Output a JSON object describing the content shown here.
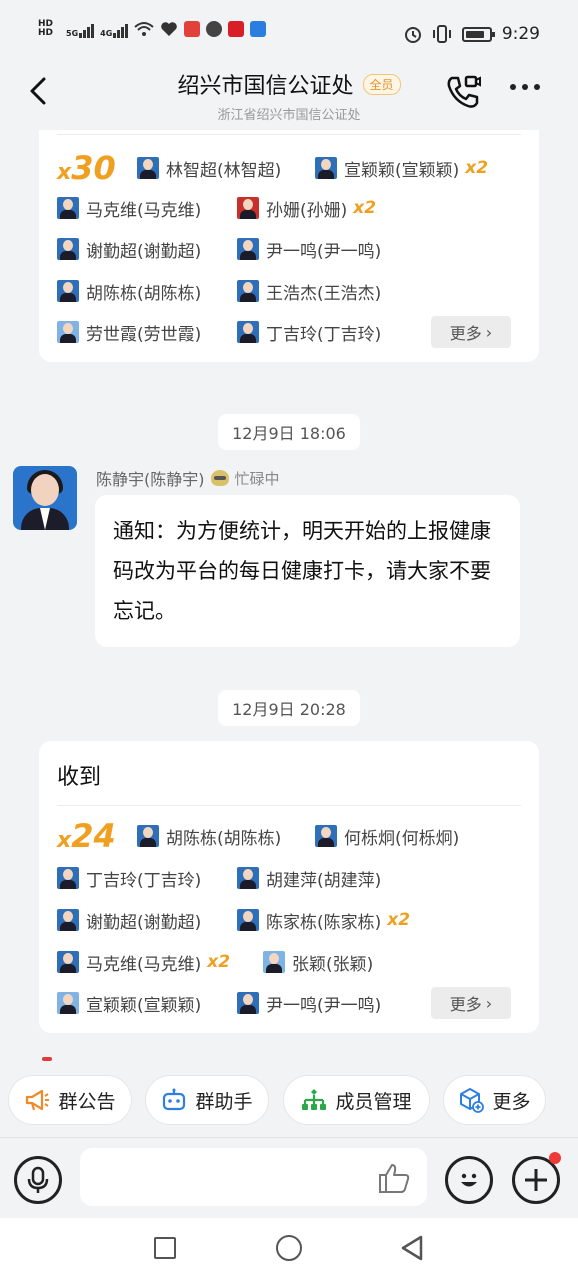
{
  "status_bar": {
    "left_labels": [
      "HD",
      "HD",
      "5G",
      "4G"
    ],
    "time": "9:29"
  },
  "header": {
    "title": "绍兴市国信公证处",
    "badge": "全员",
    "subtitle": "浙江省绍兴市国信公证处"
  },
  "card1": {
    "count_prefix": "x",
    "count": "30",
    "rows": [
      [
        {
          "name": "林智超(林智超)"
        },
        {
          "name": "宣颖颖(宣颖颖)",
          "multi": "x2"
        }
      ],
      [
        {
          "name": "马克维(马克维)"
        },
        {
          "name": "孙姗(孙姗)",
          "multi": "x2",
          "avatar": "red"
        }
      ],
      [
        {
          "name": "谢勤超(谢勤超)"
        },
        {
          "name": "尹一鸣(尹一鸣)"
        }
      ],
      [
        {
          "name": "胡陈栋(胡陈栋)"
        },
        {
          "name": "王浩杰(王浩杰)"
        }
      ],
      [
        {
          "name": "劳世霞(劳世霞)"
        },
        {
          "name": "丁吉玲(丁吉玲)"
        }
      ]
    ],
    "more_label": "更多"
  },
  "time1": "12月9日 18:06",
  "message": {
    "sender": "陈静宇(陈静宇)",
    "status": "忙碌中",
    "text": "通知：为方便统计，明天开始的上报健康码改为平台的每日健康打卡，请大家不要忘记。"
  },
  "time2": "12月9日 20:28",
  "card2": {
    "title": "收到",
    "count_prefix": "x",
    "count": "24",
    "rows": [
      [
        {
          "name": "胡陈栋(胡陈栋)"
        },
        {
          "name": "何栎炯(何栎炯)"
        }
      ],
      [
        {
          "name": "丁吉玲(丁吉玲)"
        },
        {
          "name": "胡建萍(胡建萍)"
        }
      ],
      [
        {
          "name": "谢勤超(谢勤超)"
        },
        {
          "name": "陈家栋(陈家栋)",
          "multi": "x2"
        }
      ],
      [
        {
          "name": "马克维(马克维)",
          "multi": "x2"
        },
        {
          "name": "张颖(张颖)",
          "avatar": "light"
        }
      ],
      [
        {
          "name": "宣颖颖(宣颖颖)"
        },
        {
          "name": "尹一鸣(尹一鸣)"
        }
      ]
    ],
    "more_label": "更多"
  },
  "quick_actions": [
    {
      "label": "群公告",
      "icon": "megaphone-icon",
      "color": "#f08a24"
    },
    {
      "label": "群助手",
      "icon": "robot-icon",
      "color": "#2d7fe0"
    },
    {
      "label": "成员管理",
      "icon": "org-chart-icon",
      "color": "#2aa84a"
    },
    {
      "label": "更多",
      "icon": "cube-plus-icon",
      "color": "#2d7fe0"
    }
  ],
  "colors": {
    "accent_orange": "#f0a020",
    "background": "#f2f3f5",
    "notification_red": "#f03a3a"
  }
}
